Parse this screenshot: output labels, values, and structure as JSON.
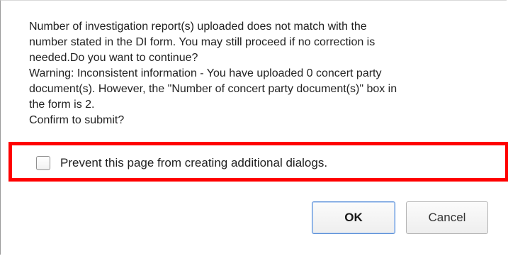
{
  "dialog": {
    "message_lines": [
      "Number of investigation report(s) uploaded does not match with the",
      "number stated in the DI form. You may still proceed if no correction is",
      "needed.Do you want to continue?",
      "Warning: Inconsistent information - You have uploaded 0 concert party",
      "document(s). However, the \"Number of concert party document(s)\" box in",
      "the form is 2.",
      "Confirm to submit?"
    ],
    "suppress_label": "Prevent this page from creating additional dialogs.",
    "ok_label": "OK",
    "cancel_label": "Cancel"
  },
  "colors": {
    "highlight": "#ff0000",
    "ok_border": "#5a8fd8"
  }
}
